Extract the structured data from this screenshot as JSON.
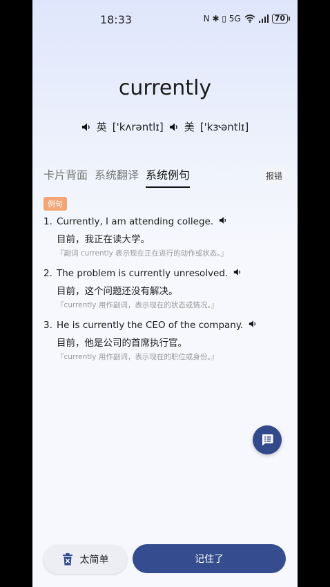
{
  "status_bar": {
    "time": "18:33",
    "icons_text": "N ✱ ▯ 5G",
    "battery": "70"
  },
  "word": "currently",
  "phonetics": [
    {
      "region": "英",
      "ipa": "['kʌrəntlɪ]"
    },
    {
      "region": "美",
      "ipa": "['kɝəntlɪ]"
    }
  ],
  "tabs": [
    {
      "label": "卡片背面",
      "active": false
    },
    {
      "label": "系统翻译",
      "active": false
    },
    {
      "label": "系统例句",
      "active": true
    }
  ],
  "report_label": "报错",
  "example_badge": "例句",
  "examples": [
    {
      "num": "1.",
      "en": "Currently, I am attending college.",
      "zh": "目前，我正在读大学。",
      "note": "『副词 currently 表示现在正在进行的动作或状态。』"
    },
    {
      "num": "2.",
      "en": "The problem is currently unresolved.",
      "zh": "目前，这个问题还没有解决。",
      "note": "『currently 用作副词，表示现在的状态或情况。』"
    },
    {
      "num": "3.",
      "en": "He is currently the CEO of the company.",
      "zh": "目前，他是公司的首席执行官。",
      "note": "『currently 用作副词，表示现在的职位或身份。』"
    }
  ],
  "buttons": {
    "too_easy": "太简单",
    "remembered": "记住了"
  },
  "colors": {
    "primary": "#354d8e",
    "badge": "#f3a576",
    "background": "#f6f8fd"
  }
}
